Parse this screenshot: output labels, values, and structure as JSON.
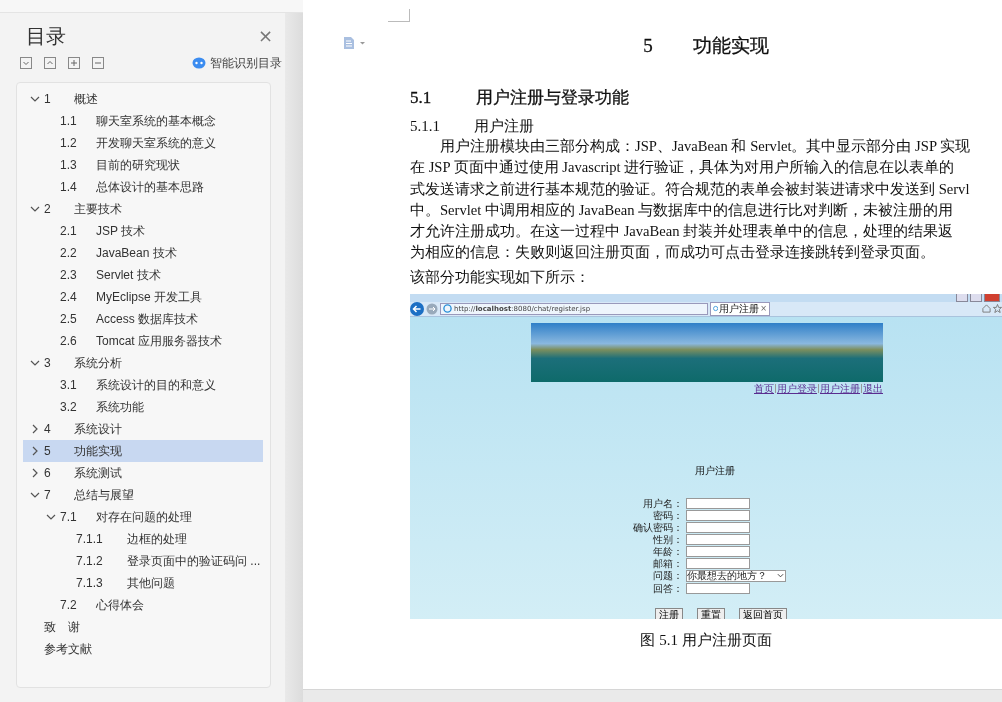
{
  "sidebar": {
    "title": "目录",
    "close": "×",
    "smart_toc": "智能识别目录",
    "toc": [
      {
        "number": "1",
        "title": "概述",
        "expanded": true,
        "selected": false,
        "children": [
          {
            "number": "1.1",
            "title": "聊天室系统的基本概念",
            "selected": false
          },
          {
            "number": "1.2",
            "title": "开发聊天室系统的意义",
            "selected": false
          },
          {
            "number": "1.3",
            "title": "目前的研究现状",
            "selected": false
          },
          {
            "number": "1.4",
            "title": "总体设计的基本思路",
            "selected": false
          }
        ]
      },
      {
        "number": "2",
        "title": "主要技术",
        "expanded": true,
        "selected": false,
        "children": [
          {
            "number": "2.1",
            "title": "JSP 技术",
            "selected": false
          },
          {
            "number": "2.2",
            "title": "JavaBean 技术",
            "selected": false
          },
          {
            "number": "2.3",
            "title": "Servlet 技术",
            "selected": false
          },
          {
            "number": "2.4",
            "title": "MyEclipse 开发工具",
            "selected": false
          },
          {
            "number": "2.5",
            "title": "Access 数据库技术",
            "selected": false
          },
          {
            "number": "2.6",
            "title": "Tomcat 应用服务器技术",
            "selected": false
          }
        ]
      },
      {
        "number": "3",
        "title": "系统分析",
        "expanded": true,
        "selected": false,
        "children": [
          {
            "number": "3.1",
            "title": "系统设计的目的和意义",
            "selected": false
          },
          {
            "number": "3.2",
            "title": "系统功能",
            "selected": false
          }
        ]
      },
      {
        "number": "4",
        "title": "系统设计",
        "expanded": false,
        "selected": false
      },
      {
        "number": "5",
        "title": "功能实现",
        "expanded": false,
        "selected": true
      },
      {
        "number": "6",
        "title": "系统测试",
        "expanded": false,
        "selected": false
      },
      {
        "number": "7",
        "title": "总结与展望",
        "expanded": true,
        "selected": false,
        "children": [
          {
            "number": "7.1",
            "title": "对存在问题的处理",
            "expanded": true,
            "selected": false,
            "children": [
              {
                "number": "7.1.1",
                "title": "边框的处理",
                "selected": false
              },
              {
                "number": "7.1.2",
                "title": "登录页面中的验证码问 ...",
                "selected": false
              },
              {
                "number": "7.1.3",
                "title": "其他问题",
                "selected": false
              }
            ]
          },
          {
            "number": "7.2",
            "title": "心得体会",
            "selected": false
          }
        ]
      },
      {
        "title": "致　谢",
        "selected": false
      },
      {
        "title": "参考文献",
        "selected": false
      }
    ]
  },
  "document": {
    "chapter": {
      "number": "5",
      "title": "功能实现"
    },
    "section": {
      "number": "5.1",
      "title": "用户注册与登录功能"
    },
    "subsection": {
      "number": "5.1.1",
      "title": "用户注册"
    },
    "paragraph_lines": [
      "用户注册模块由三部分构成：JSP、JavaBean 和 Servlet。其中显示部分由 JSP 实现",
      "在 JSP 页面中通过使用 Javascript 进行验证，具体为对用户所输入的信息在以表单的",
      "式发送请求之前进行基本规范的验证。符合规范的表单会被封装进请求中发送到 Servl",
      "中。Servlet 中调用相应的 JavaBean 与数据库中的信息进行比对判断，未被注册的用",
      "才允许注册成功。在这一过程中 JavaBean 封装并处理表单中的信息，处理的结果返",
      "为相应的信息：失败则返回注册页面，而成功可点击登录连接跳转到登录页面。"
    ],
    "intro": "该部分功能实现如下所示：",
    "figure": {
      "address": "http://**localhost**:8080/chat/register.jsp",
      "tab": "用户注册",
      "tab_close": "×",
      "nav_links": [
        "首页",
        "用户登录",
        "用户注册",
        "退出"
      ],
      "form_title": "用户注册",
      "fields": [
        {
          "label": "用户名：",
          "kind": "text"
        },
        {
          "label": "密码：",
          "kind": "text"
        },
        {
          "label": "确认密码：",
          "kind": "text"
        },
        {
          "label": "性别：",
          "kind": "text"
        },
        {
          "label": "年龄：",
          "kind": "text"
        },
        {
          "label": "邮箱：",
          "kind": "text"
        },
        {
          "label": "问题：",
          "kind": "select",
          "value": "你最想去的地方？"
        },
        {
          "label": "回答：",
          "kind": "text"
        }
      ],
      "buttons": [
        "注册",
        "重置",
        "返回首页"
      ]
    },
    "caption": "图 5.1 用户注册页面"
  }
}
